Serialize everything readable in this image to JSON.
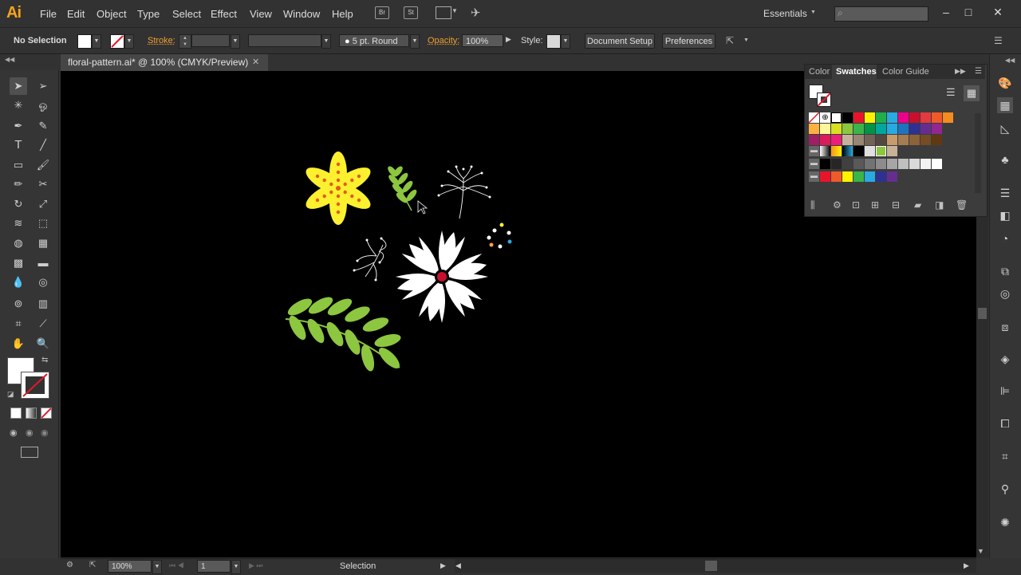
{
  "app": {
    "logo": "Ai"
  },
  "menu": [
    "File",
    "Edit",
    "Object",
    "Type",
    "Select",
    "Effect",
    "View",
    "Window",
    "Help"
  ],
  "appbar": {
    "bridge": "Br",
    "stock": "St",
    "workspace": "Essentials"
  },
  "control": {
    "selection": "No Selection",
    "stroke_label": "Stroke:",
    "brush": "5 pt. Round",
    "opacity_label": "Opacity:",
    "opacity": "100%",
    "style_label": "Style:",
    "doc_setup": "Document Setup",
    "preferences": "Preferences"
  },
  "document": {
    "tab": "floral-pattern.ai* @ 100% (CMYK/Preview)"
  },
  "panel": {
    "tabs": [
      "Color",
      "Swatches",
      "Color Guide"
    ],
    "active": "Swatches"
  },
  "swatches": {
    "row1": [
      "#e8152a",
      "#fff200",
      "#1fb04b",
      "#29aae1",
      "#ec008c",
      "#c8102e",
      "#e43a3e",
      "#f05a28",
      "#f68b1f"
    ],
    "row2": [
      "#fbb040",
      "#fff799",
      "#d7e021",
      "#8dc63f",
      "#39b54a",
      "#009444",
      "#00a79d",
      "#27aae1",
      "#1c75bc",
      "#2e3192",
      "#662d91",
      "#92278f"
    ],
    "row3": [
      "#9e1f63",
      "#d91c5c",
      "#ed1e79",
      "#c7b299",
      "#998675",
      "#736357",
      "#534741",
      "#c69c6d",
      "#a67c52",
      "#8c6239",
      "#754c24",
      "#603913"
    ],
    "row5": [
      "#000000",
      "#262626",
      "#404040",
      "#595959",
      "#737373",
      "#8c8c8c",
      "#a6a6a6",
      "#bfbfbf",
      "#d9d9d9",
      "#f2f2f2",
      "#ffffff"
    ],
    "row6": [
      "#e8152a",
      "#f05a28",
      "#fff200",
      "#39b54a",
      "#29aae1",
      "#2e3192",
      "#662d91"
    ]
  },
  "status": {
    "zoom": "100%",
    "artboard": "1",
    "tool": "Selection"
  }
}
